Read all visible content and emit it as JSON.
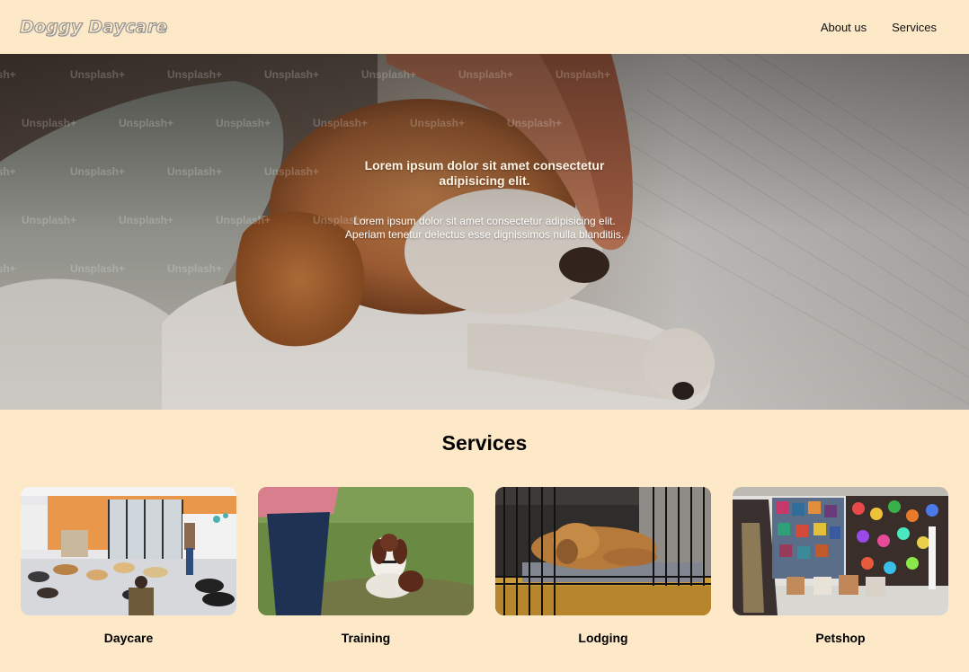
{
  "header": {
    "logo": "Doggy Daycare",
    "nav": [
      "About us",
      "Services"
    ]
  },
  "hero": {
    "title": "Lorem ipsum dolor sit amet consectetur adipisicing elit.",
    "subtitle_line1": "Lorem ipsum dolor sit amet consectetur adipisicing elit.",
    "subtitle_line2": "Aperiam tenetur delectus esse dignissimos nulla blanditiis.",
    "watermark": "Unsplash+"
  },
  "services": {
    "title": "Services",
    "cards": [
      {
        "label": "Daycare"
      },
      {
        "label": "Training"
      },
      {
        "label": "Lodging"
      },
      {
        "label": "Petshop"
      }
    ]
  },
  "colors": {
    "background": "#fde9c8",
    "text": "#111111"
  }
}
